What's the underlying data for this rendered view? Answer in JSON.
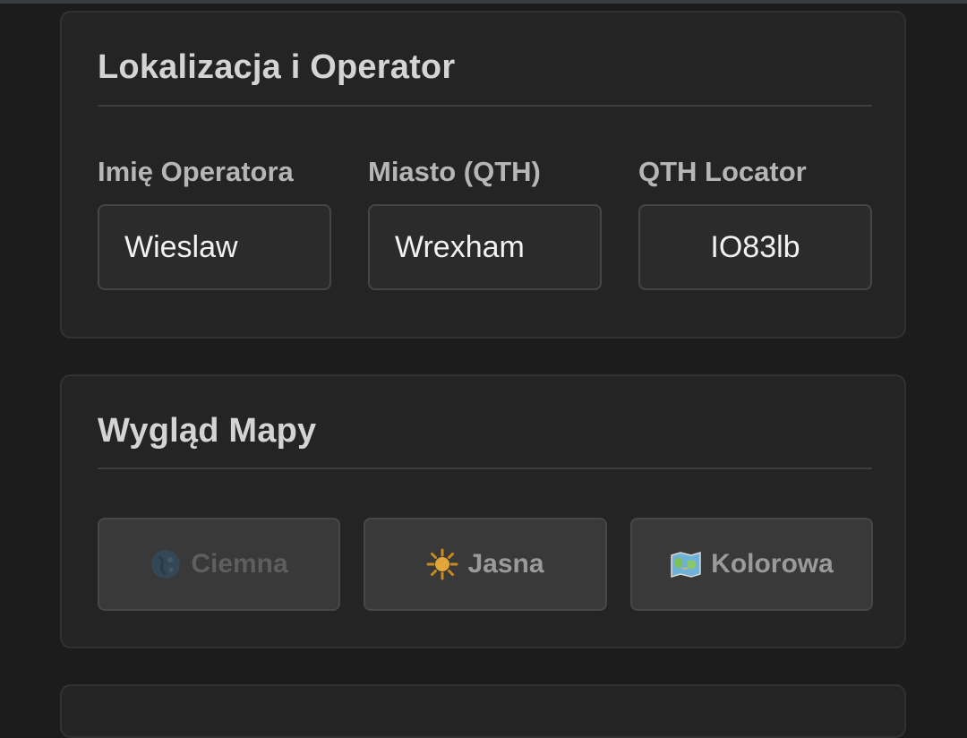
{
  "location_section": {
    "title": "Lokalizacja i Operator",
    "fields": [
      {
        "label": "Imię Operatora",
        "value": "Wieslaw"
      },
      {
        "label": "Miasto (QTH)",
        "value": "Wrexham"
      },
      {
        "label": "QTH Locator",
        "value": "IO83lb"
      }
    ]
  },
  "map_section": {
    "title": "Wygląd Mapy",
    "themes": [
      {
        "label": "Ciemna",
        "icon": "moon-icon"
      },
      {
        "label": "Jasna",
        "icon": "sun-icon"
      },
      {
        "label": "Kolorowa",
        "icon": "map-icon"
      }
    ]
  }
}
